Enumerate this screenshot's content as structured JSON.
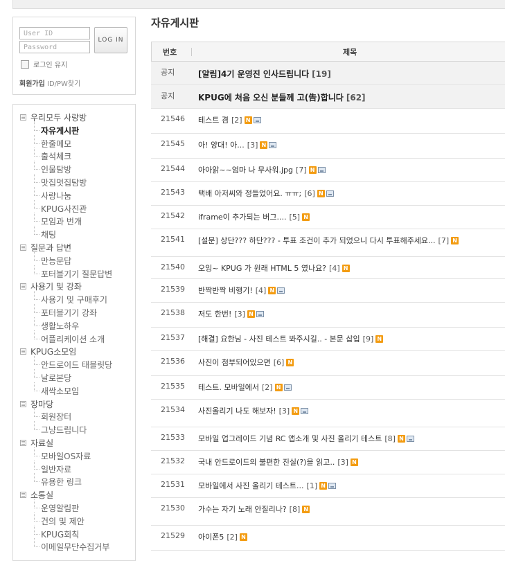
{
  "login": {
    "id_placeholder": "User ID",
    "pw_placeholder": "Password",
    "button_label": "LOG IN",
    "keep_label": "로그인 유지",
    "join_label": "회원가입",
    "find_label": "ID/PW찾기"
  },
  "sidebar": {
    "categories": [
      {
        "label": "우리모두 사랑방",
        "items": [
          "자유게시판",
          "한줄메모",
          "출석체크",
          "인물탐방",
          "맛집멋집탐방",
          "사랑나눔",
          "KPUG사진관",
          "모임과 번개",
          "채팅"
        ]
      },
      {
        "label": "질문과 답변",
        "items": [
          "만능문답",
          "포터블기기 질문답변"
        ]
      },
      {
        "label": "사용기 및 강좌",
        "items": [
          "사용기 및 구매후기",
          "포터블기기 강좌",
          "생활노하우",
          "어플리케이션 소개"
        ]
      },
      {
        "label": "KPUG소모임",
        "items": [
          "안드로이드 태블릿당",
          "날로본당",
          "새싹소모임"
        ]
      },
      {
        "label": "장마당",
        "items": [
          "회원장터",
          "그냥드립니다"
        ]
      },
      {
        "label": "자료실",
        "items": [
          "모바일OS자료",
          "일반자료",
          "유용한 링크"
        ]
      },
      {
        "label": "소통실",
        "items": [
          "운영알림판",
          "건의 및 제안",
          "KPUG회칙",
          "이메일무단수집거부"
        ]
      }
    ],
    "active_item": "자유게시판"
  },
  "board": {
    "title": "자유게시판",
    "col_num": "번호",
    "col_title": "제목",
    "notices": [
      {
        "num": "공지",
        "title": "[알림]4기 운영진 인사드립니다",
        "count": "[19]"
      },
      {
        "num": "공지",
        "title": "KPUG에 처음 오신 분들께 고(告)합니다",
        "count": "[62]"
      }
    ],
    "posts": [
      {
        "num": "21546",
        "title": "테스트 겸",
        "count": "[2]",
        "photo": true
      },
      {
        "num": "21545",
        "title": "아! 양대! 아...",
        "count": "[3]",
        "photo": true
      },
      {
        "num": "21544",
        "title": "아아앍~~엄마 나 무사워.jpg",
        "count": "[7]",
        "photo": true
      },
      {
        "num": "21543",
        "title": "택배 아저씨와 정들었어요. ㅠㅠ;",
        "count": "[6]",
        "photo": true
      },
      {
        "num": "21542",
        "title": "iframe이 추가되는 버그....",
        "count": "[5]",
        "photo": false
      },
      {
        "num": "21541",
        "title": "[설문] 상단??? 하단??? - 투표 조건이 추가 되었으니 다시 투표해주세요...",
        "count": "[7]",
        "photo": false
      },
      {
        "num": "21540",
        "title": "오잉~ KPUG 가 원래 HTML 5 였나요?",
        "count": "[4]",
        "photo": false
      },
      {
        "num": "21539",
        "title": "반짝반짝 비행기!",
        "count": "[4]",
        "photo": true
      },
      {
        "num": "21538",
        "title": "저도 한번!",
        "count": "[3]",
        "photo": true
      },
      {
        "num": "21537",
        "title": "[해결] 요한님 - 사진 테스트 봐주시길.. - 본문 삽입",
        "count": "[9]",
        "photo": false
      },
      {
        "num": "21536",
        "title": "사진이 첨부되어있으면",
        "count": "[6]",
        "photo": false
      },
      {
        "num": "21535",
        "title": "테스트. 모바일에서",
        "count": "[2]",
        "photo": true
      },
      {
        "num": "21534",
        "title": "사진올리기 나도 해보자!",
        "count": "[3]",
        "photo": true
      },
      {
        "num": "21533",
        "title": "모바일 업그레이드 기념 RC 앱소개 및 사진 올리기 테스트",
        "count": "[8]",
        "photo": true
      },
      {
        "num": "21532",
        "title": "국내 안드로이드의 불편한 진실(?)을 읽고..",
        "count": "[3]",
        "photo": false
      },
      {
        "num": "21531",
        "title": "모바일에서 사진 올리기 테스트...",
        "count": "[1]",
        "photo": true
      },
      {
        "num": "21530",
        "title": "가수는 자기 노래 안질리나?",
        "count": "[8]",
        "photo": false
      },
      {
        "num": "21529",
        "title": "아이폰5",
        "count": "[2]",
        "photo": false
      }
    ],
    "new_badge": "N"
  }
}
